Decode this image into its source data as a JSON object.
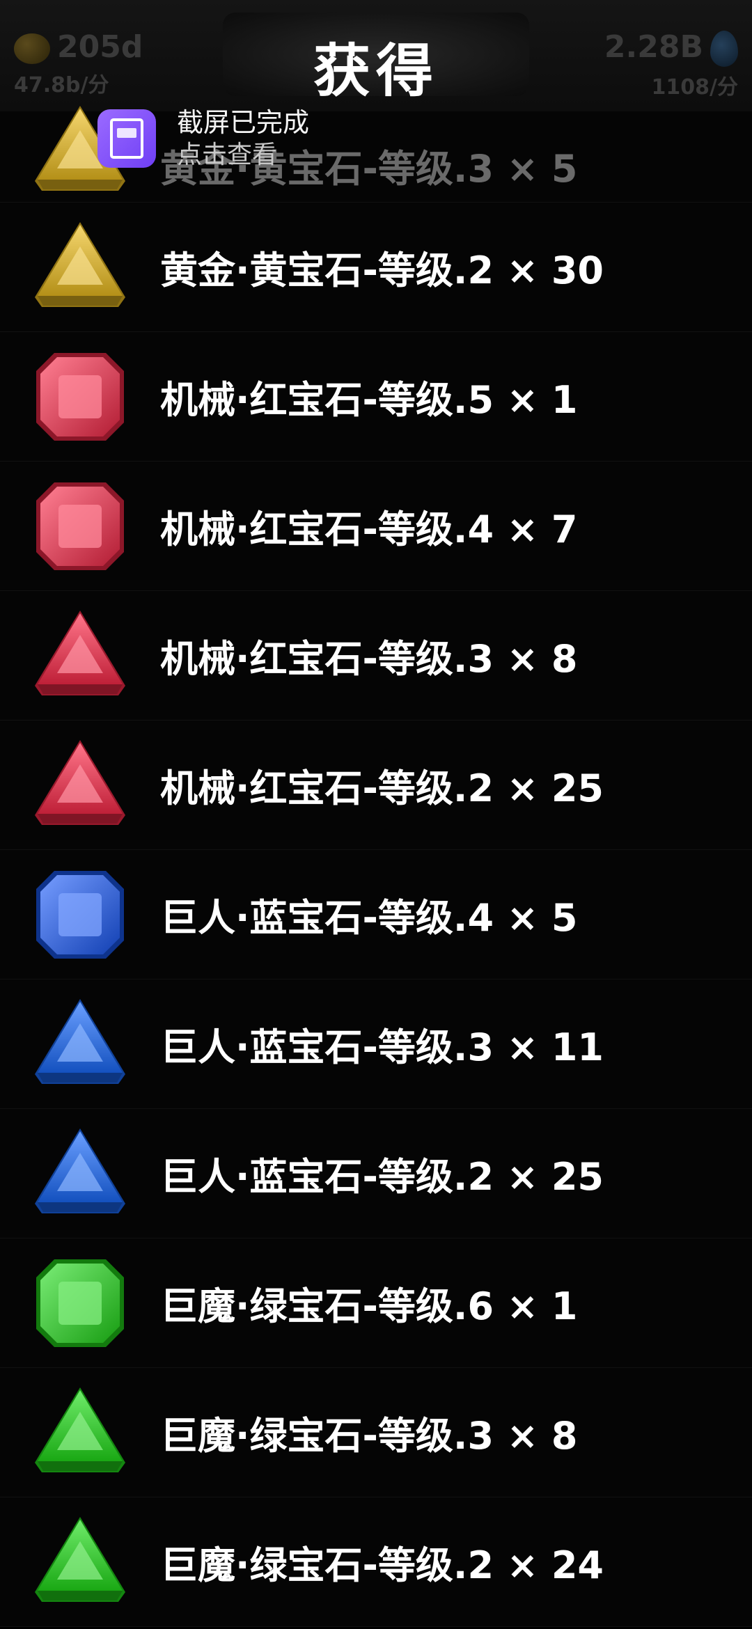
{
  "header": {
    "title": "获得",
    "left_value": "205d",
    "left_rate": "47.8b/分",
    "right_value": "2.28B",
    "right_rate": "1108/分"
  },
  "toast": {
    "line1": "截屏已完成",
    "line2": "点击查看"
  },
  "items": [
    {
      "label": "黄金·黄宝石-等级.3 × 5",
      "gem": "yellow-triangle-gem",
      "color": "#f0c020",
      "shape": "triangle"
    },
    {
      "label": "黄金·黄宝石-等级.2 × 30",
      "gem": "yellow-triangle-gem",
      "color": "#f0c020",
      "shape": "triangle"
    },
    {
      "label": "机械·红宝石-等级.5 × 1",
      "gem": "red-square-gem",
      "color": "#ff2a4a",
      "shape": "square"
    },
    {
      "label": "机械·红宝石-等级.4 × 7",
      "gem": "red-square-gem",
      "color": "#ff2a4a",
      "shape": "square"
    },
    {
      "label": "机械·红宝石-等级.3 × 8",
      "gem": "red-triangle-gem",
      "color": "#ff2a4a",
      "shape": "triangle"
    },
    {
      "label": "机械·红宝石-等级.2 × 25",
      "gem": "red-triangle-gem",
      "color": "#ff2a4a",
      "shape": "triangle"
    },
    {
      "label": "巨人·蓝宝石-等级.4 × 5",
      "gem": "blue-square-gem",
      "color": "#1a5cff",
      "shape": "square"
    },
    {
      "label": "巨人·蓝宝石-等级.3 × 11",
      "gem": "blue-triangle-gem",
      "color": "#1a6cff",
      "shape": "triangle"
    },
    {
      "label": "巨人·蓝宝石-等级.2 × 25",
      "gem": "blue-triangle-gem",
      "color": "#1a6cff",
      "shape": "triangle"
    },
    {
      "label": "巨魔·绿宝石-等级.6 × 1",
      "gem": "green-square-gem",
      "color": "#22e01a",
      "shape": "square"
    },
    {
      "label": "巨魔·绿宝石-等级.3 × 8",
      "gem": "green-triangle-gem",
      "color": "#22e01a",
      "shape": "triangle"
    },
    {
      "label": "巨魔·绿宝石-等级.2 × 24",
      "gem": "green-triangle-gem",
      "color": "#22e01a",
      "shape": "triangle"
    }
  ]
}
